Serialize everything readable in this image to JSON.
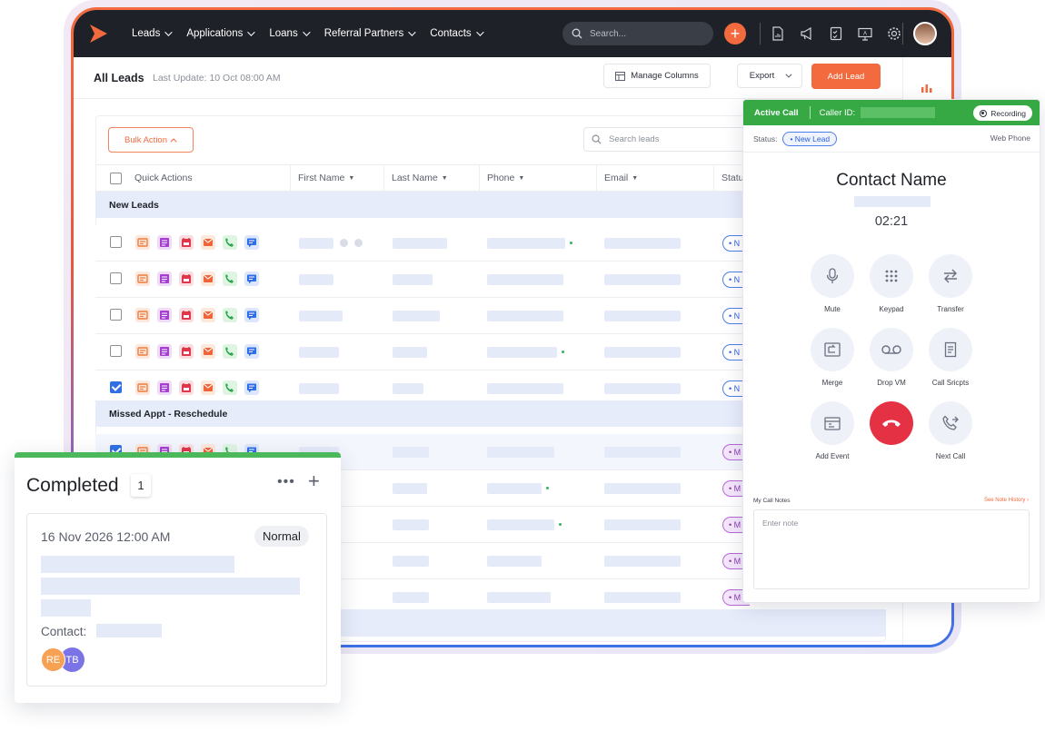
{
  "topbar": {
    "nav": [
      {
        "label": "Leads"
      },
      {
        "label": "Applications"
      },
      {
        "label": "Loans"
      },
      {
        "label": "Referral Partners"
      },
      {
        "label": "Contacts"
      }
    ],
    "search_placeholder": "Search...",
    "brand_color": "#f26a3d"
  },
  "header": {
    "title": "All Leads",
    "last_update": "Last Update: 10 Oct 08:00 AM",
    "manage_columns": "Manage Columns",
    "export": "Export",
    "add_lead": "Add Lead"
  },
  "table": {
    "bulk_action": "Bulk Action",
    "search_placeholder": "Search leads",
    "columns": [
      "Quick Actions",
      "First Name",
      "Last Name",
      "Phone",
      "Email",
      "Status"
    ],
    "groups": [
      "New Leads",
      "Missed Appt - Reschedule"
    ],
    "status_new": "N",
    "status_missed": "M"
  },
  "call": {
    "title": "Active Call",
    "caller_id_label": "Caller ID:",
    "recording": "Recording",
    "status_label": "Status:",
    "status_value": "• New Lead",
    "web_phone": "Web Phone",
    "contact_name": "Contact Name",
    "timer": "02:21",
    "buttons": {
      "mute": "Mute",
      "keypad": "Keypad",
      "transfer": "Transfer",
      "merge": "Merge",
      "drop_vm": "Drop VM",
      "call_scripts": "Call Sricpts",
      "add_event": "Add Event",
      "next_call": "Next Call"
    },
    "notes_label": "My Call Notes",
    "notes_history": "See Note History ›",
    "notes_placeholder": "Enter note",
    "header_color": "#36a944",
    "hangup_color": "#e53144"
  },
  "completed": {
    "title": "Completed",
    "count": "1",
    "date": "16 Nov 2026 12:00 AM",
    "priority": "Normal",
    "contact_label": "Contact:",
    "avatars": [
      "RE",
      "TB"
    ]
  }
}
